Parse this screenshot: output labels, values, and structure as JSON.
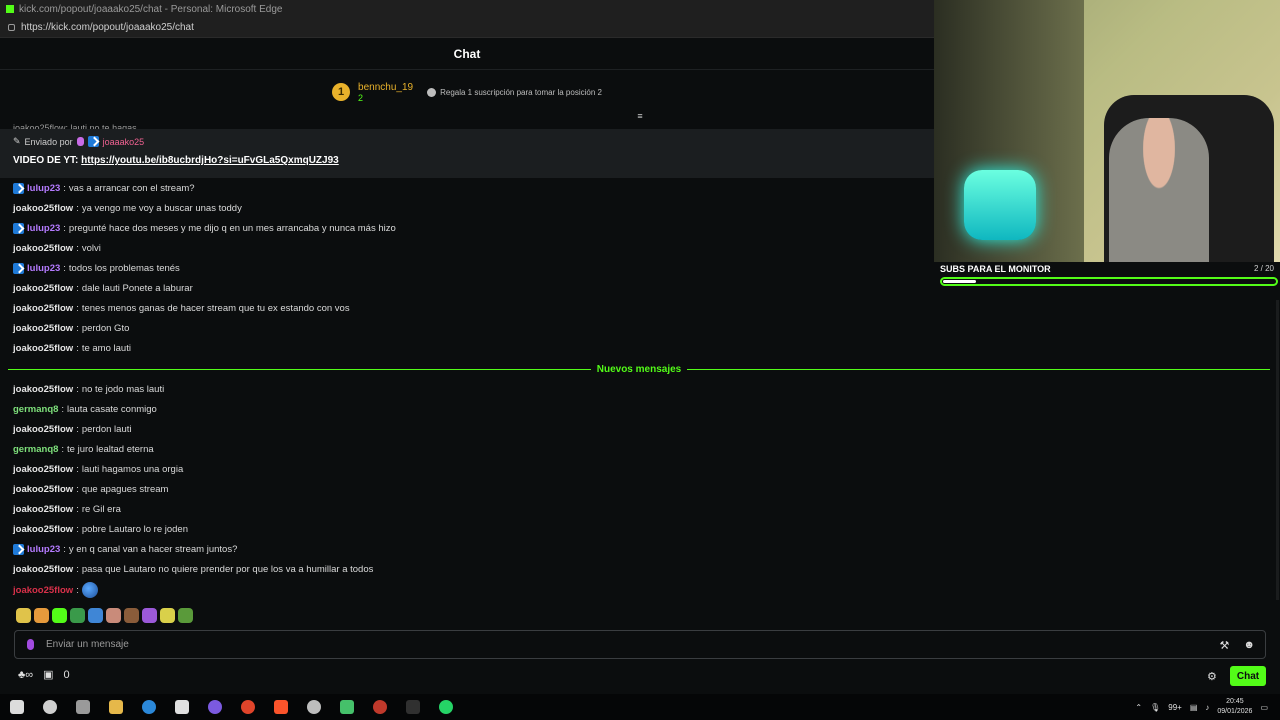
{
  "window": {
    "title": "kick.com/popout/joaaako25/chat - Personal: Microsoft Edge",
    "url": "https://kick.com/popout/joaaako25/chat"
  },
  "chat": {
    "header": "Chat",
    "leaderboard": {
      "rank": "1",
      "username": "bennchu_19",
      "count": "2",
      "gift_text": "Regala 1 suscripción para tomar la posición 2"
    },
    "peek_text": "joakoo25flow: lauti no te hagas",
    "pinned": {
      "sent_by": "Enviado por",
      "user": "joaaako25",
      "prefix": "VIDEO DE YT:",
      "link": "https://youtu.be/ib8ucbrdjHo?si=uFvGLa5QxmqUZJ93"
    },
    "messages": [
      {
        "user": "lulup23",
        "color": "purple",
        "badge": true,
        "text": "vas a arrancar con el stream?"
      },
      {
        "user": "joakoo25flow",
        "color": "white",
        "badge": false,
        "text": "ya vengo me voy a buscar unas toddy"
      },
      {
        "user": "lulup23",
        "color": "purple",
        "badge": true,
        "text": "pregunté hace dos meses y me dijo q en un mes arrancaba y nunca más hizo"
      },
      {
        "user": "joakoo25flow",
        "color": "white",
        "badge": false,
        "text": "volvi"
      },
      {
        "user": "lulup23",
        "color": "purple",
        "badge": true,
        "text": "todos los problemas tenés"
      },
      {
        "user": "joakoo25flow",
        "color": "white",
        "badge": false,
        "text": "dale lauti Ponete a laburar"
      },
      {
        "user": "joakoo25flow",
        "color": "white",
        "badge": false,
        "text": "tenes menos ganas de hacer stream que tu ex estando con vos"
      },
      {
        "user": "joakoo25flow",
        "color": "white",
        "badge": false,
        "text": "perdon Gto"
      },
      {
        "user": "joakoo25flow",
        "color": "white",
        "badge": false,
        "text": "te amo lauti"
      }
    ],
    "new_messages_label": "Nuevos mensajes",
    "new_messages": [
      {
        "user": "joakoo25flow",
        "color": "white",
        "badge": false,
        "text": "no te jodo mas lauti"
      },
      {
        "user": "germanq8",
        "color": "green",
        "badge": false,
        "text": "lauta casate conmigo"
      },
      {
        "user": "joakoo25flow",
        "color": "white",
        "badge": false,
        "text": "perdon lauti"
      },
      {
        "user": "germanq8",
        "color": "green",
        "badge": false,
        "text": "te juro lealtad eterna"
      },
      {
        "user": "joakoo25flow",
        "color": "white",
        "badge": false,
        "text": "lauti hagamos una orgia"
      },
      {
        "user": "joakoo25flow",
        "color": "white",
        "badge": false,
        "text": "que apagues stream"
      },
      {
        "user": "joakoo25flow",
        "color": "white",
        "badge": false,
        "text": "re Gil era"
      },
      {
        "user": "joakoo25flow",
        "color": "white",
        "badge": false,
        "text": "pobre Lautaro lo re joden"
      },
      {
        "user": "lulup23",
        "color": "purple",
        "badge": true,
        "text": "y en q canal van a hacer stream juntos?"
      },
      {
        "user": "joakoo25flow",
        "color": "white",
        "badge": false,
        "text": "pasa que Lautaro no quiere prender por que los va a humillar a todos"
      },
      {
        "user": "joakoo25flow",
        "color": "red",
        "badge": false,
        "text": "",
        "emote": "earth-emote"
      }
    ],
    "input_placeholder": "Enviar un mensaje",
    "viewer_count": "0",
    "chat_button": "Chat"
  },
  "overlay": {
    "title": "SUBS PARA EL MONITOR",
    "count": "2 / 20",
    "progress": 0.1
  },
  "taskbar": {
    "time": "20:45",
    "date": "09/01/2026",
    "notif_badge": "99+"
  },
  "colors": {
    "accent": "#53fc18",
    "bg": "#0b0d0e"
  }
}
